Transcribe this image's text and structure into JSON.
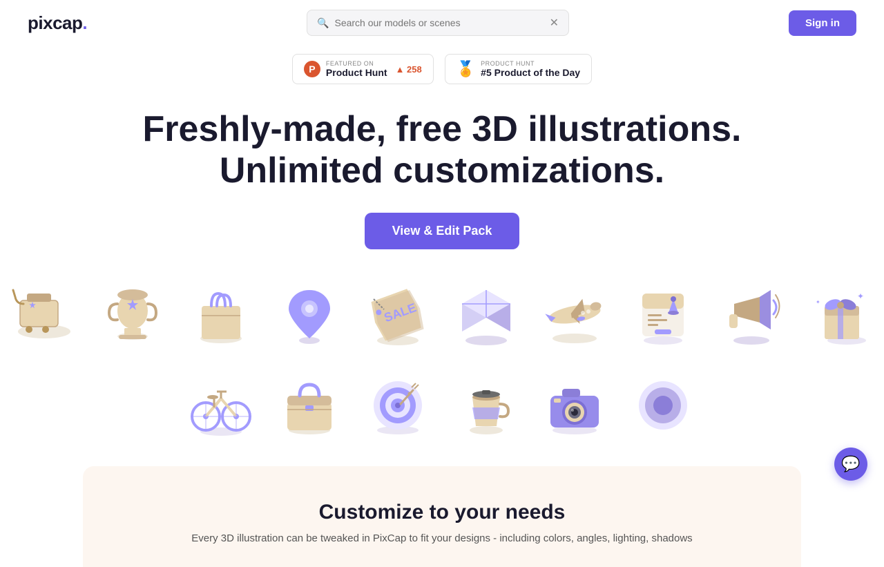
{
  "navbar": {
    "logo_text": "pixcap",
    "logo_dot": ".",
    "search_placeholder": "Search our models or scenes",
    "signin_label": "Sign in"
  },
  "badges": [
    {
      "id": "producthunt",
      "featured_label": "FEATURED ON",
      "name": "Product Hunt",
      "count": "258",
      "icon_letter": "P"
    },
    {
      "id": "producthunt2",
      "hunt_label": "PRODUCT HUNT",
      "name": "#5 Product of the Day",
      "medal": "🏅"
    }
  ],
  "hero": {
    "title_line1": "Freshly-made, free 3D illustrations.",
    "title_line2": "Unlimited customizations.",
    "cta_label": "View & Edit Pack"
  },
  "customize": {
    "title": "Customize to your needs",
    "description": "Every 3D illustration can be tweaked in PixCap to fit your designs - including colors, angles,\nlighting, shadows"
  },
  "chat": {
    "icon": "💬"
  }
}
